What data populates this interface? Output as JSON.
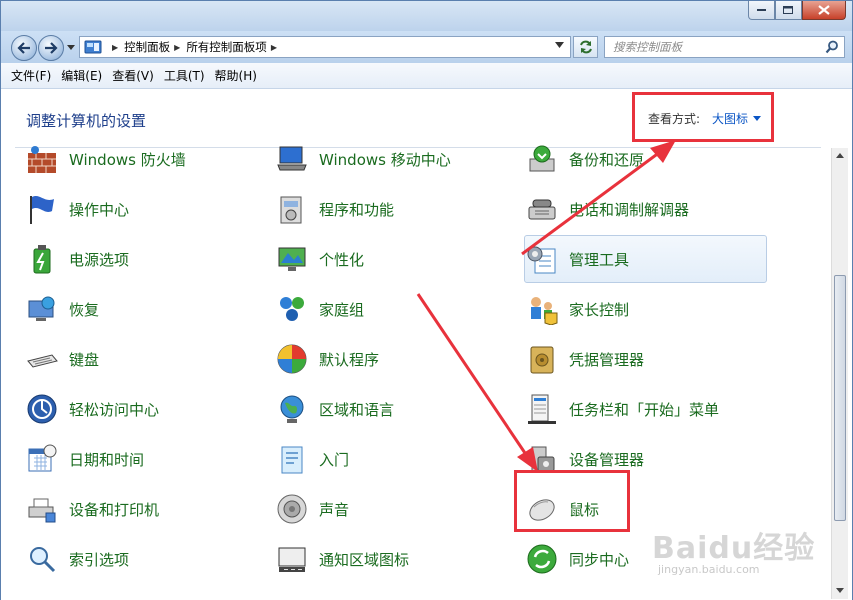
{
  "breadcrumb": {
    "items": [
      "控制面板",
      "所有控制面板项"
    ]
  },
  "search": {
    "placeholder": "搜索控制面板"
  },
  "menu": [
    "文件(F)",
    "编辑(E)",
    "查看(V)",
    "工具(T)",
    "帮助(H)"
  ],
  "page_title": "调整计算机的设置",
  "view_by": {
    "label": "查看方式:",
    "value": "大图标"
  },
  "items": [
    {
      "label": "Windows 防火墙",
      "icon": "firewall-icon"
    },
    {
      "label": "Windows 移动中心",
      "icon": "mobility-center-icon"
    },
    {
      "label": "备份和还原",
      "icon": "backup-restore-icon"
    },
    {
      "label": "操作中心",
      "icon": "action-center-flag-icon"
    },
    {
      "label": "程序和功能",
      "icon": "programs-features-icon"
    },
    {
      "label": "电话和调制解调器",
      "icon": "phone-modem-icon"
    },
    {
      "label": "电源选项",
      "icon": "power-options-icon"
    },
    {
      "label": "个性化",
      "icon": "personalization-icon"
    },
    {
      "label": "管理工具",
      "icon": "admin-tools-icon"
    },
    {
      "label": "恢复",
      "icon": "recovery-icon"
    },
    {
      "label": "家庭组",
      "icon": "homegroup-icon"
    },
    {
      "label": "家长控制",
      "icon": "parental-controls-icon"
    },
    {
      "label": "键盘",
      "icon": "keyboard-icon"
    },
    {
      "label": "默认程序",
      "icon": "default-programs-icon"
    },
    {
      "label": "凭据管理器",
      "icon": "credential-manager-icon"
    },
    {
      "label": "轻松访问中心",
      "icon": "ease-of-access-icon"
    },
    {
      "label": "区域和语言",
      "icon": "region-language-icon"
    },
    {
      "label": "任务栏和「开始」菜单",
      "icon": "taskbar-start-menu-icon"
    },
    {
      "label": "日期和时间",
      "icon": "date-time-icon"
    },
    {
      "label": "入门",
      "icon": "getting-started-icon"
    },
    {
      "label": "设备管理器",
      "icon": "device-manager-icon"
    },
    {
      "label": "设备和打印机",
      "icon": "devices-printers-icon"
    },
    {
      "label": "声音",
      "icon": "sound-icon"
    },
    {
      "label": "鼠标",
      "icon": "mouse-icon"
    },
    {
      "label": "索引选项",
      "icon": "indexing-options-icon"
    },
    {
      "label": "通知区域图标",
      "icon": "notification-area-icon"
    },
    {
      "label": "同步中心",
      "icon": "sync-center-icon"
    }
  ],
  "watermark": {
    "main": "Baidu经验",
    "sub": "jingyan.baidu.com"
  },
  "colors": {
    "link_green": "#1a6b1f",
    "title_blue": "#1e3f8b",
    "highlight_red": "#e8323c"
  }
}
